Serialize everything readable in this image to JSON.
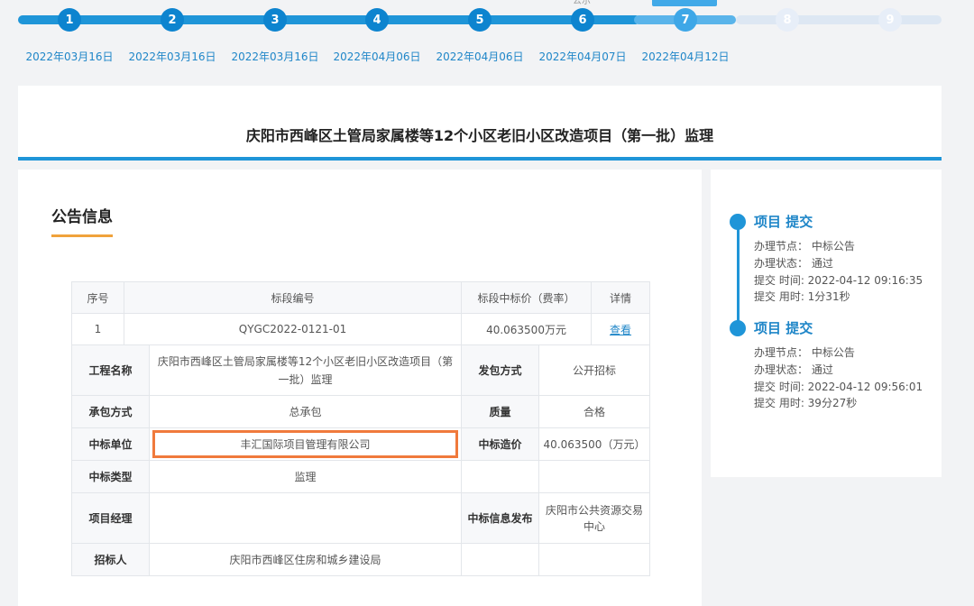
{
  "steps": [
    {
      "num": "1",
      "date": "2022年03月16日",
      "state": "done"
    },
    {
      "num": "2",
      "date": "2022年03月16日",
      "state": "done"
    },
    {
      "num": "3",
      "date": "2022年03月16日",
      "state": "done"
    },
    {
      "num": "4",
      "date": "2022年04月06日",
      "state": "done"
    },
    {
      "num": "5",
      "date": "2022年04月06日",
      "state": "done"
    },
    {
      "num": "6",
      "date": "2022年04月07日",
      "state": "done"
    },
    {
      "num": "7",
      "date": "2022年04月12日",
      "state": "current"
    },
    {
      "num": "8",
      "date": "",
      "state": "todo"
    },
    {
      "num": "9",
      "date": "",
      "state": "todo"
    }
  ],
  "project": {
    "title": "庆阳市西峰区土管局家属楼等12个小区老旧小区改造项目（第一批）监理"
  },
  "announcement": {
    "heading": "公告信息",
    "headers": {
      "seq": "序号",
      "code": "标段编号",
      "price": "标段中标价（费率）",
      "detail": "详情"
    },
    "row": {
      "seq": "1",
      "code": "QYGC2022-0121-01",
      "price": "40.063500万元",
      "detail_link": "查看"
    },
    "fields": {
      "project_name_label": "工程名称",
      "project_name": "庆阳市西峰区土管局家属楼等12个小区老旧小区改造项目（第一批）监理",
      "bid_method_label": "发包方式",
      "bid_method": "公开招标",
      "contract_mode_label": "承包方式",
      "contract_mode": "总承包",
      "quality_label": "质量",
      "quality": "合格",
      "winner_label": "中标单位",
      "winner": "丰汇国际项目管理有限公司",
      "win_price_label": "中标造价",
      "win_price": "40.063500（万元）",
      "win_type_label": "中标类型",
      "win_type": "监理",
      "pm_label": "项目经理",
      "pm": "",
      "publisher_label": "中标信息发布",
      "publisher": "庆阳市公共资源交易中心",
      "tenderer_label": "招标人",
      "tenderer": "庆阳市西峰区住房和城乡建设局"
    }
  },
  "timeline": [
    {
      "title": "项目 提交",
      "node": "办理节点：  中标公告",
      "status": "办理状态：  通过",
      "time": "提交 时间:   2022-04-12 09:16:35",
      "duration": "提交 用时:   1分31秒"
    },
    {
      "title": "项目 提交",
      "node": "办理节点：  中标公告",
      "status": "办理状态：  通过",
      "time": "提交 时间:   2022-04-12 09:56:01",
      "duration": "提交 用时:   39分27秒"
    }
  ],
  "colors": {
    "accent": "#1f95d8",
    "highlight_box": "#f07a3c",
    "heading_underline": "#f0a23b"
  }
}
